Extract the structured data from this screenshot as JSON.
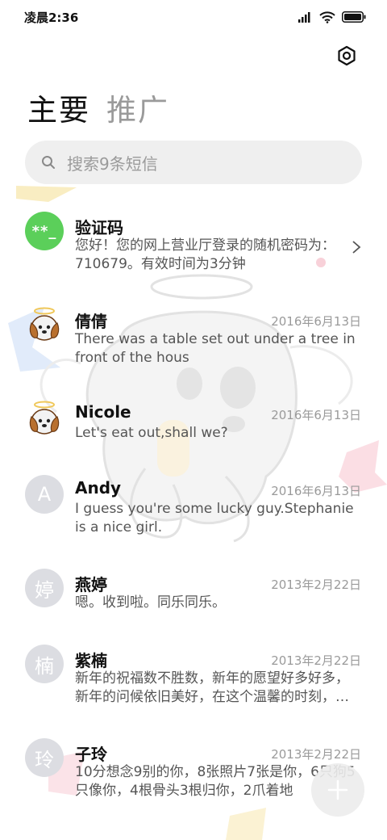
{
  "status": {
    "time": "凌晨2:36"
  },
  "tabs": [
    {
      "label": "主要"
    },
    {
      "label": "推广"
    }
  ],
  "search": {
    "placeholder": "搜索9条短信"
  },
  "conversations": [
    {
      "name": "验证码",
      "avatar": "**_",
      "date": "",
      "preview": "您好！您的网上营业厅登录的随机密码为：710679。有效时间为3分钟"
    },
    {
      "name": "倩倩",
      "avatar": "dog-avatar",
      "date": "2016年6月13日",
      "preview": "There was a table set out under a tree in front of the hous"
    },
    {
      "name": "Nicole",
      "avatar": "dog-avatar",
      "date": "2016年6月13日",
      "preview": "Let's eat out,shall we?"
    },
    {
      "name": "Andy",
      "avatar": "A",
      "date": "2016年6月13日",
      "preview": "I guess you're some lucky guy.Stephanie is a nice girl."
    },
    {
      "name": "燕婷",
      "avatar": "婷",
      "date": "2013年2月22日",
      "preview": "嗯。收到啦。同乐同乐。"
    },
    {
      "name": "紫楠",
      "avatar": "楠",
      "date": "2013年2月22日",
      "preview": "新年的祝福数不胜数，新年的愿望好多好多，新年的问候依旧美好，在这个温馨的时刻，…"
    },
    {
      "name": "子玲",
      "avatar": "玲",
      "date": "2013年2月22日",
      "preview": "10分想念9别的你，8张照片7张是你，6只狗5只像你，4根骨头3根归你，2爪着地"
    }
  ],
  "icons": {
    "settings": "gear-icon",
    "search": "search-icon",
    "chevron": "chevron-right-icon",
    "fab": "plus-icon"
  },
  "colors": {
    "verification_avatar": "#5bcf5a",
    "letter_avatar": "#dcdde2"
  }
}
